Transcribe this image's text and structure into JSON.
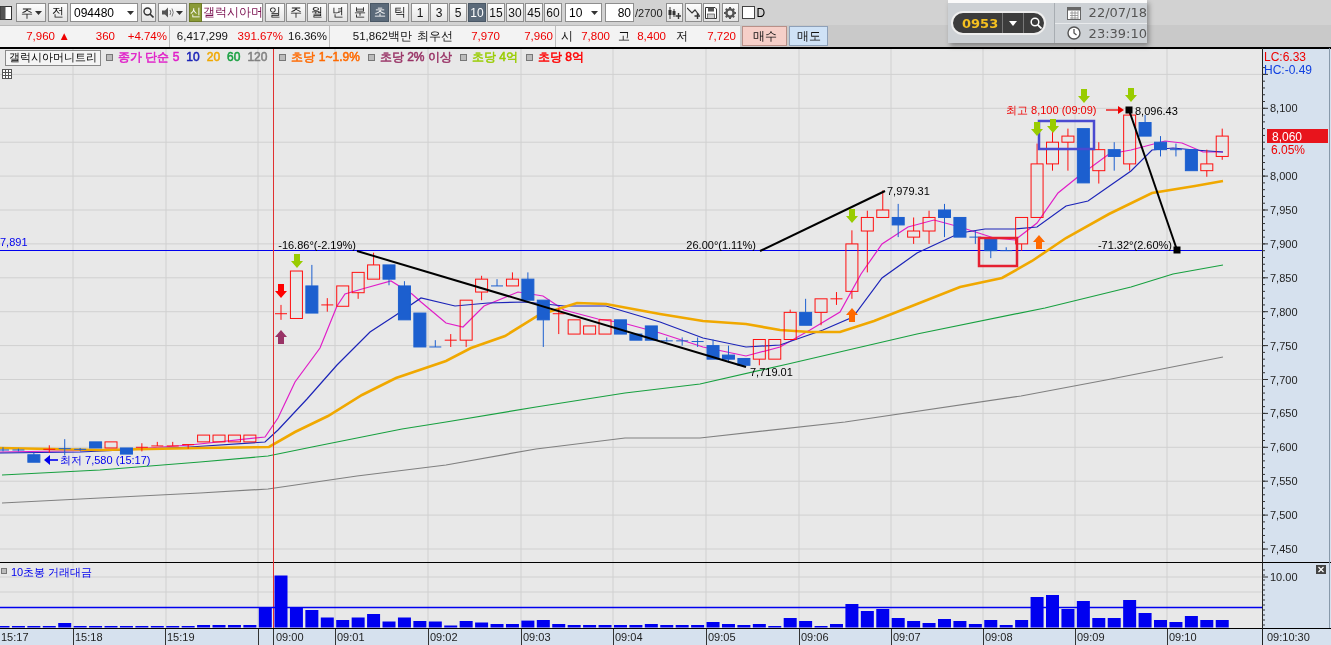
{
  "toolbar": {
    "market_select": {
      "value": "주"
    },
    "prev_button": {
      "label": "전"
    },
    "code_field": {
      "value": "094480"
    },
    "credit_badge": {
      "label": "신"
    },
    "stock_name": "갤럭시아머",
    "period_tabs": [
      {
        "label": "일",
        "selected": false
      },
      {
        "label": "주",
        "selected": false
      },
      {
        "label": "월",
        "selected": false
      },
      {
        "label": "년",
        "selected": false
      }
    ],
    "unit_tabs": [
      {
        "label": "분",
        "selected": false
      },
      {
        "label": "초",
        "selected": true
      },
      {
        "label": "틱",
        "selected": false
      }
    ],
    "interval_tabs": [
      {
        "label": "1",
        "selected": false
      },
      {
        "label": "3",
        "selected": false
      },
      {
        "label": "5",
        "selected": false
      },
      {
        "label": "10",
        "selected": true
      },
      {
        "label": "15",
        "selected": false
      },
      {
        "label": "30",
        "selected": false
      },
      {
        "label": "45",
        "selected": false
      },
      {
        "label": "60",
        "selected": false
      }
    ],
    "interval_select": {
      "value": "10"
    },
    "count_field": {
      "value": "80"
    },
    "count_total": "/2700",
    "d_checkbox": {
      "label": "D",
      "checked": false
    }
  },
  "quote_bar": {
    "items": [
      {
        "text": "7,960",
        "rising": true
      },
      {
        "text": "▲",
        "rising": true
      },
      {
        "text": "360",
        "rising": true
      },
      {
        "text": "+4.74%",
        "rising": true
      },
      {
        "text": "6,417,299",
        "rising": false
      },
      {
        "text": "391.67%",
        "rising": true
      },
      {
        "text": "16.36%",
        "rising": false
      },
      {
        "text": "51,862백만",
        "rising": false
      },
      {
        "text": "최우선",
        "rising": false
      },
      {
        "text": "7,970",
        "rising": true
      },
      {
        "text": "7,960",
        "rising": true
      },
      {
        "text": "시",
        "rising": false
      },
      {
        "text": "7,800",
        "rising": true
      },
      {
        "text": "고",
        "rising": false
      },
      {
        "text": "8,400",
        "rising": true
      },
      {
        "text": "저",
        "rising": false
      },
      {
        "text": "7,720",
        "rising": true
      }
    ],
    "order_buttons": [
      {
        "label": "매수",
        "kind": "buy"
      },
      {
        "label": "매도",
        "kind": "sell"
      }
    ]
  },
  "quick_panel": {
    "code": "0953",
    "date": "22/07/18",
    "time": "23:39:10"
  },
  "legend": {
    "title": "갤럭시아머니트리",
    "moving_averages": [
      {
        "label": "종가 단순 5",
        "color": "#e01ec8"
      },
      {
        "label": "10",
        "color": "#1c24b8"
      },
      {
        "label": "20",
        "color": "#f0a800"
      },
      {
        "label": "60",
        "color": "#18a040"
      },
      {
        "label": "120",
        "color": "#808080"
      }
    ],
    "signals": [
      {
        "label": "초당 1~1.9%",
        "color": "#ff6a00"
      },
      {
        "label": "초당 2% 이상",
        "color": "#993366"
      },
      {
        "label": "초당 4억",
        "color": "#99cc00"
      },
      {
        "label": "초당 8억",
        "color": "#ff0000"
      }
    ]
  },
  "price_chart": {
    "reference_label": "7,891",
    "trend_lines": [
      {
        "angle_label": "-16.86°(-2.19%)",
        "end_label": "7,719.01"
      },
      {
        "angle_label": "26.00°(1.11%)",
        "end_label": "7,979.31"
      },
      {
        "angle_label": "-71.32°(2.60%)",
        "end_label": "8,096.43"
      }
    ],
    "high_label": "최고 8,100 (09:09)",
    "low_label": "최저 7,580 (15:17)",
    "y_axis": {
      "lc": "LC:6.33",
      "hc": "HC:-0.49",
      "ticks": [
        "8,100",
        "8,000",
        "7,950",
        "7,900",
        "7,850",
        "7,800",
        "7,750",
        "7,700",
        "7,650",
        "7,600",
        "7,550",
        "7,500",
        "7,450"
      ],
      "current_price": "8,060",
      "current_change": "6.05%"
    }
  },
  "volume_chart": {
    "title": "10초봉 거래대금",
    "axis_label": "10.00"
  },
  "time_axis": {
    "labels": [
      "15:17",
      "15:18",
      "15:19",
      "09:00",
      "09:01",
      "09:02",
      "09:03",
      "09:04",
      "09:05",
      "09:06",
      "09:07",
      "09:08",
      "09:09",
      "09:10"
    ],
    "end_label": "09:10:30"
  }
}
